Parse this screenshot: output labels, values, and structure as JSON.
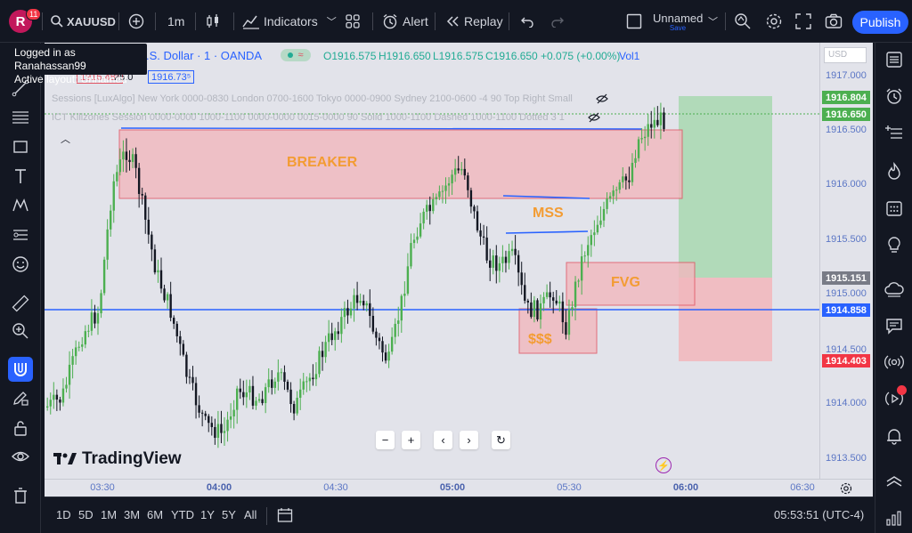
{
  "topbar": {
    "avatar_initial": "R",
    "notification_count": "11",
    "symbol": "XAUUSD",
    "interval": "1m",
    "indicators_label": "Indicators",
    "alert_label": "Alert",
    "replay_label": "Replay",
    "layout_name": "Unnamed",
    "save_label": "Save",
    "publish_label": "Publish"
  },
  "tooltip": {
    "line1": "Logged in as Ranahassan99",
    "line2": "Active layout: Unnamed"
  },
  "legend": {
    "symbol_title": ".S. Dollar · 1 · OANDA",
    "open": "O1916.575",
    "high": "H1916.650",
    "low": "L1916.575",
    "close": "C1916.650",
    "change": "+0.075 (+0.00%)",
    "volume": "Vol1",
    "bid": "1916.48⁵",
    "spread": "25.0",
    "ask": "1916.73⁵"
  },
  "indicators": [
    "Sessions [LuxAlgo] New York 0000-0830 London 0700-1600 Tokyo 0000-0900 Sydney 2100-0600 -4 90 Top Right Small",
    "ICT Killzones Session 0000-0000 1000-1100 0000-0000 0015-0000 90 Solid 1000-1100 Dashed 1000-1100 Dotted 3 1"
  ],
  "zones": {
    "breaker": "BREAKER",
    "mss": "MSS",
    "fvg": "FVG",
    "sss": "$$$"
  },
  "watermark": "TradingView",
  "price_axis": {
    "currency": "USD",
    "ticks": [
      "1917.000",
      "1916.500",
      "1916.000",
      "1915.500",
      "1915.000",
      "1914.500",
      "1914.000",
      "1913.500"
    ],
    "tag_last": "1916.804",
    "tag_current": "1916.650",
    "tag_grey": "1915.151",
    "tag_blue": "1914.858",
    "tag_red": "1914.403"
  },
  "time_axis": {
    "ticks": [
      "03:30",
      "04:00",
      "04:30",
      "05:00",
      "05:30",
      "06:00",
      "06:30"
    ]
  },
  "bottom": {
    "ranges": [
      "1D",
      "5D",
      "1M",
      "3M",
      "6M",
      "YTD",
      "1Y",
      "5Y",
      "All"
    ],
    "clock": "05:53:51 (UTC-4)"
  },
  "colors": {
    "bull": "#4caf50",
    "bear": "#131722",
    "breaker_zone": "#f2b8be",
    "fvg_zone": "#f2b8be",
    "target_zone": "#a8d8b0",
    "stop_zone": "#f2b8be",
    "accent": "#2962ff"
  }
}
